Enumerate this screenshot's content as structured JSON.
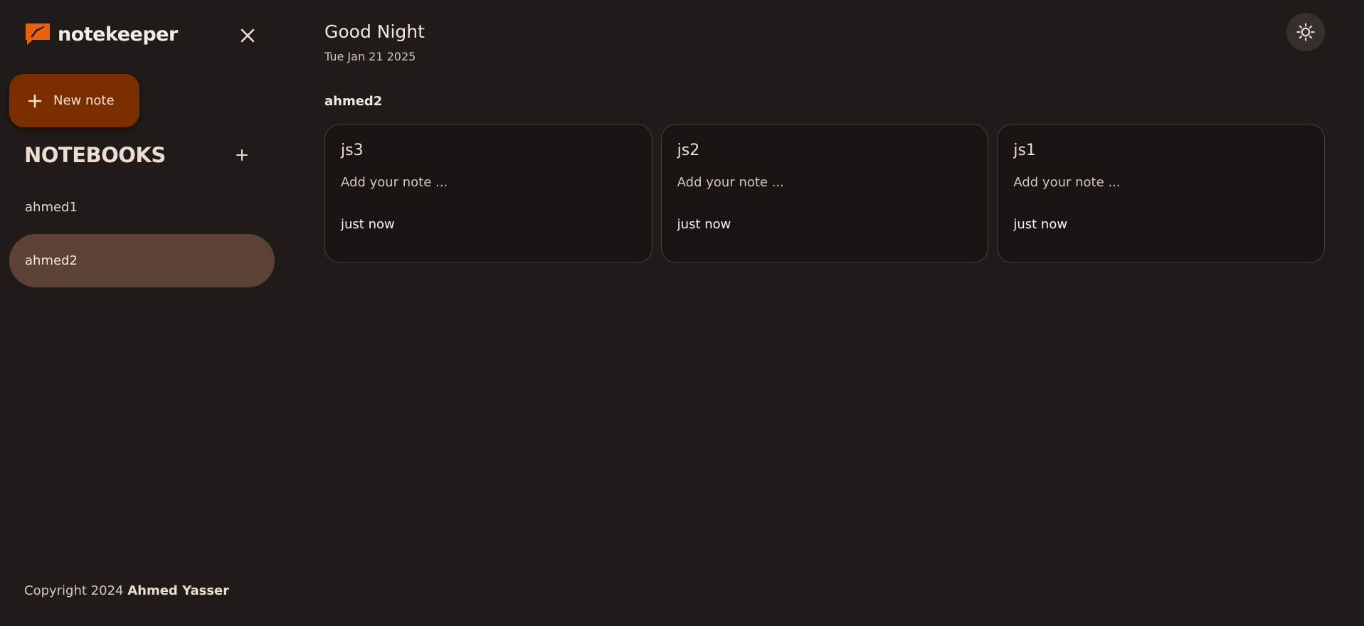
{
  "sidebar": {
    "brand": "notekeeper",
    "new_note_label": "New note",
    "notebooks_title": "NOTEBOOKS",
    "notebooks": [
      {
        "label": "ahmed1",
        "active": false
      },
      {
        "label": "ahmed2",
        "active": true
      }
    ],
    "copyright_prefix": "Copyright 2024",
    "copyright_name": "Ahmed Yasser"
  },
  "main": {
    "greeting": "Good Night",
    "date": "Tue Jan 21 2025",
    "section_title": "ahmed2",
    "notes": [
      {
        "title": "js3",
        "body": "Add your note ...",
        "time": "just now"
      },
      {
        "title": "js2",
        "body": "Add your note ...",
        "time": "just now"
      },
      {
        "title": "js1",
        "body": "Add your note ...",
        "time": "just now"
      }
    ]
  },
  "icons": {
    "brand": "notekeeper-logo-icon",
    "close": "close-icon",
    "add": "plus-icon",
    "theme": "sun-icon"
  },
  "colors": {
    "background": "#201b19",
    "accent": "#e8620c",
    "new_note_button": "#7a2e00",
    "active_notebook": "#5c4236",
    "card_background": "#191412"
  }
}
